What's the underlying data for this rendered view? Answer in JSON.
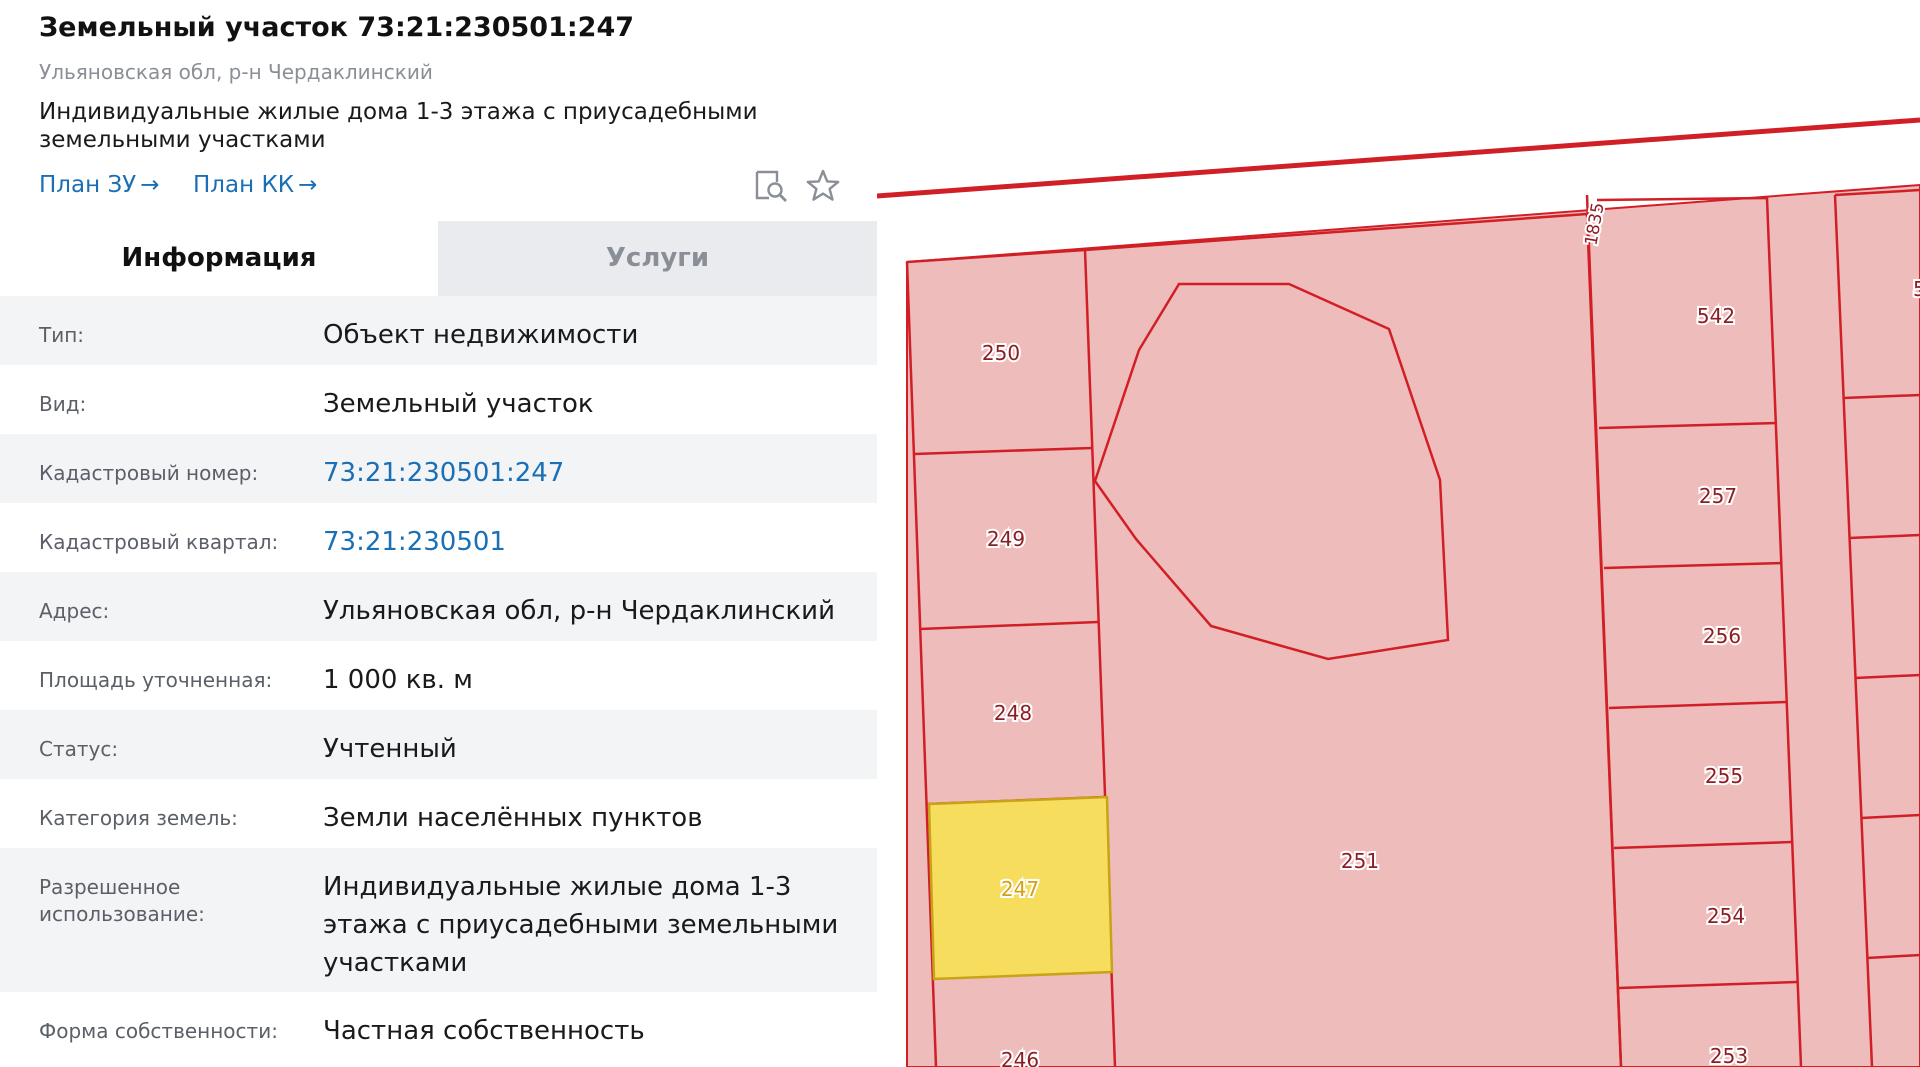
{
  "header": {
    "title": "Земельный участок 73:21:230501:247",
    "address": "Ульяновская обл, р-н Чердаклинский",
    "usage": "Индивидуальные жилые дома 1-3 этажа с приусадебными земельными участками",
    "links": [
      {
        "label": "План ЗУ",
        "arrow": "→"
      },
      {
        "label": "План КК",
        "arrow": "→"
      }
    ],
    "icons": [
      "search-document-icon",
      "star-icon"
    ]
  },
  "tabs": [
    {
      "label": "Информация",
      "active": true
    },
    {
      "label": "Услуги",
      "active": false
    }
  ],
  "info": [
    {
      "label": "Тип:",
      "value": "Объект недвижимости"
    },
    {
      "label": "Вид:",
      "value": "Земельный участок"
    },
    {
      "label": "Кадастровый номер:",
      "value": "73:21:230501:247",
      "link": true
    },
    {
      "label": "Кадастровый квартал:",
      "value": "73:21:230501",
      "link": true
    },
    {
      "label": "Адрес:",
      "value": "Ульяновская обл, р-н Чердаклинский"
    },
    {
      "label": "Площадь уточненная:",
      "value": "1 000 кв. м"
    },
    {
      "label": "Статус:",
      "value": "Учтенный"
    },
    {
      "label": "Категория земель:",
      "value": "Земли населённых пунктов"
    },
    {
      "label": "Разрешенное использование:",
      "value": "Индивидуальные жилые дома 1-3 этажа с приусадебными земельными участками"
    },
    {
      "label": "Форма собственности:",
      "value": "Частная собственность"
    }
  ],
  "map": {
    "parcel_labels": [
      "250",
      "249",
      "248",
      "247",
      "246",
      "251",
      "1835",
      "542",
      "257",
      "256",
      "255",
      "254",
      "253",
      "5"
    ],
    "colors": {
      "parcel_fill": "#efbcbc",
      "parcel_stroke": "#d11f26",
      "selected_fill": "#f6dd5e",
      "selected_stroke": "#c8a316",
      "link": "#1a6fb5"
    }
  }
}
